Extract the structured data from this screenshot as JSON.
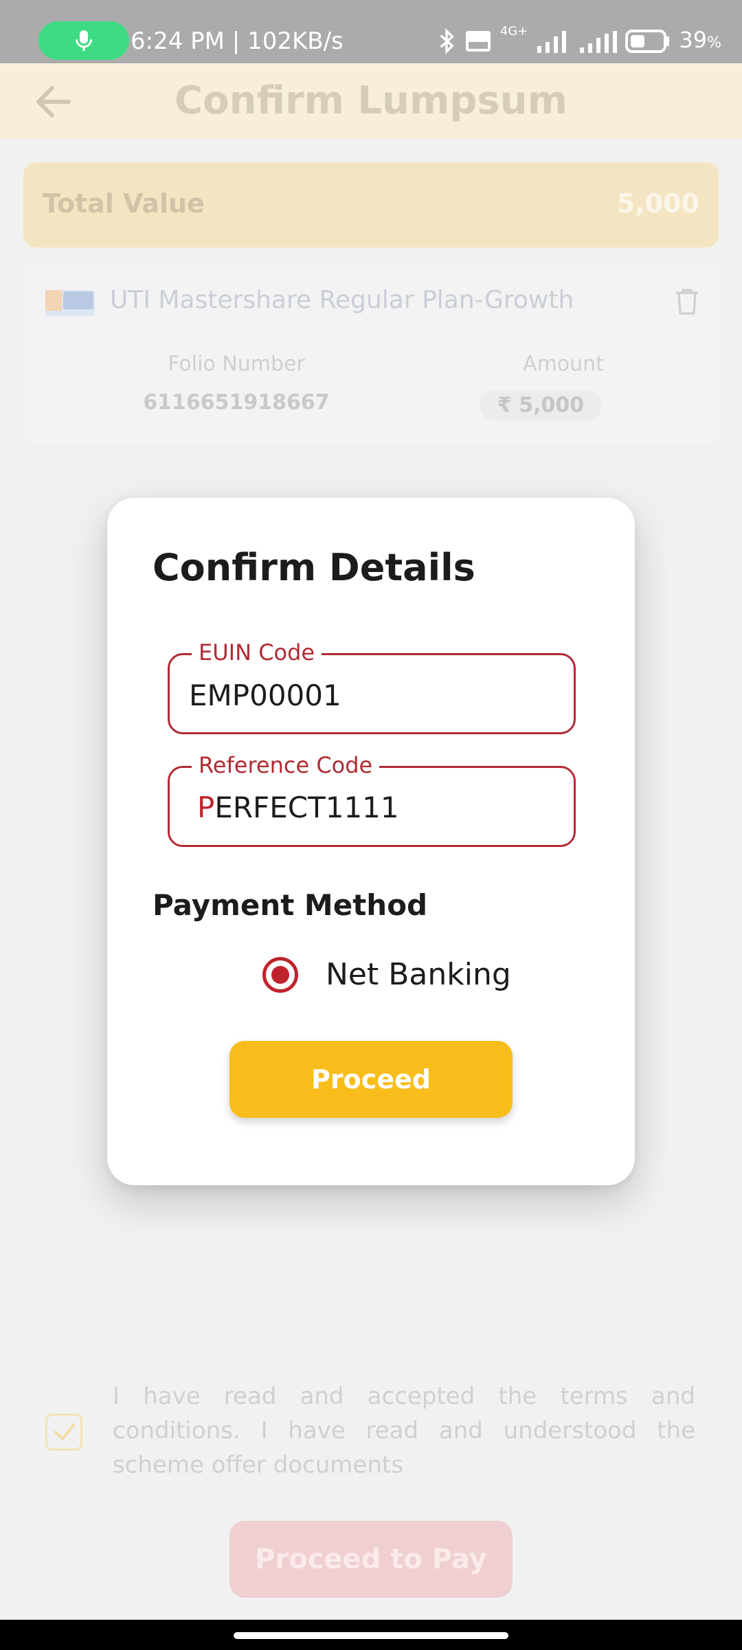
{
  "status_bar": {
    "time": "6:24 PM | 102KB/s",
    "network": "4G+",
    "battery_percent": "39",
    "battery_suffix": "%"
  },
  "header": {
    "title": "Confirm Lumpsum"
  },
  "total": {
    "label": "Total Value",
    "value": "5,000"
  },
  "fund": {
    "name": "UTI Mastershare Regular Plan-Growth",
    "folio_label": "Folio Number",
    "folio_value": "6116651918667",
    "amount_label": "Amount",
    "amount_value": "₹ 5,000"
  },
  "modal": {
    "title": "Confirm Details",
    "euin_label": "EUIN Code",
    "euin_value": "EMP00001",
    "ref_label": "Reference Code",
    "ref_first_char": "P",
    "ref_rest": "ERFECT1111",
    "payment_heading": "Payment Method",
    "payment_option": "Net Banking",
    "proceed_label": "Proceed"
  },
  "terms": {
    "text": "I have read and accepted the terms and conditions. I have read and understood the scheme offer documents"
  },
  "footer": {
    "proceed_to_pay_label": "Proceed to Pay"
  },
  "colors": {
    "accent_red": "#c0232d",
    "accent_yellow": "#f9bd1b"
  }
}
